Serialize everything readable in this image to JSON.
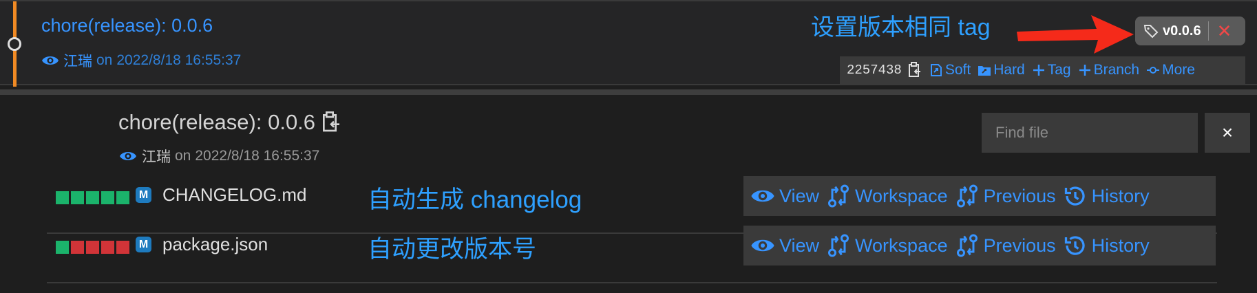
{
  "commit": {
    "title": "chore(release): 0.0.6",
    "author": "江瑞",
    "on": "on",
    "date": "2022/8/18 16:55:37",
    "hash": "2257438",
    "tag": "v0.0.6",
    "tag_close": "✕"
  },
  "annotations": {
    "tag": "设置版本相同 tag",
    "changelog": "自动生成 changelog",
    "version": "自动更改版本号"
  },
  "actions": [
    "Soft",
    "Hard",
    "Tag",
    "Branch",
    "More"
  ],
  "detail": {
    "title": "chore(release): 0.0.6",
    "author": "江瑞",
    "on": "on",
    "date": "2022/8/18 16:55:37"
  },
  "find": {
    "placeholder": "Find file",
    "close": "×"
  },
  "files": [
    {
      "name": "CHANGELOG.md",
      "status": "M",
      "added_blocks": 5,
      "removed_blocks": 0
    },
    {
      "name": "package.json",
      "status": "M",
      "added_blocks": 1,
      "removed_blocks": 4
    }
  ],
  "file_actions": [
    "View",
    "Workspace",
    "Previous",
    "History"
  ],
  "colors": {
    "accent": "#3794ff",
    "graph": "#f08a24",
    "added": "#1bb36b",
    "removed": "#d13438",
    "annotation": "#2ea0ff",
    "close": "#f04848"
  },
  "icons": [
    "eye-icon",
    "copy-icon",
    "tag-icon",
    "soft-reset-icon",
    "hard-reset-icon",
    "plus-icon",
    "more-icon",
    "compare-icon",
    "history-icon"
  ]
}
